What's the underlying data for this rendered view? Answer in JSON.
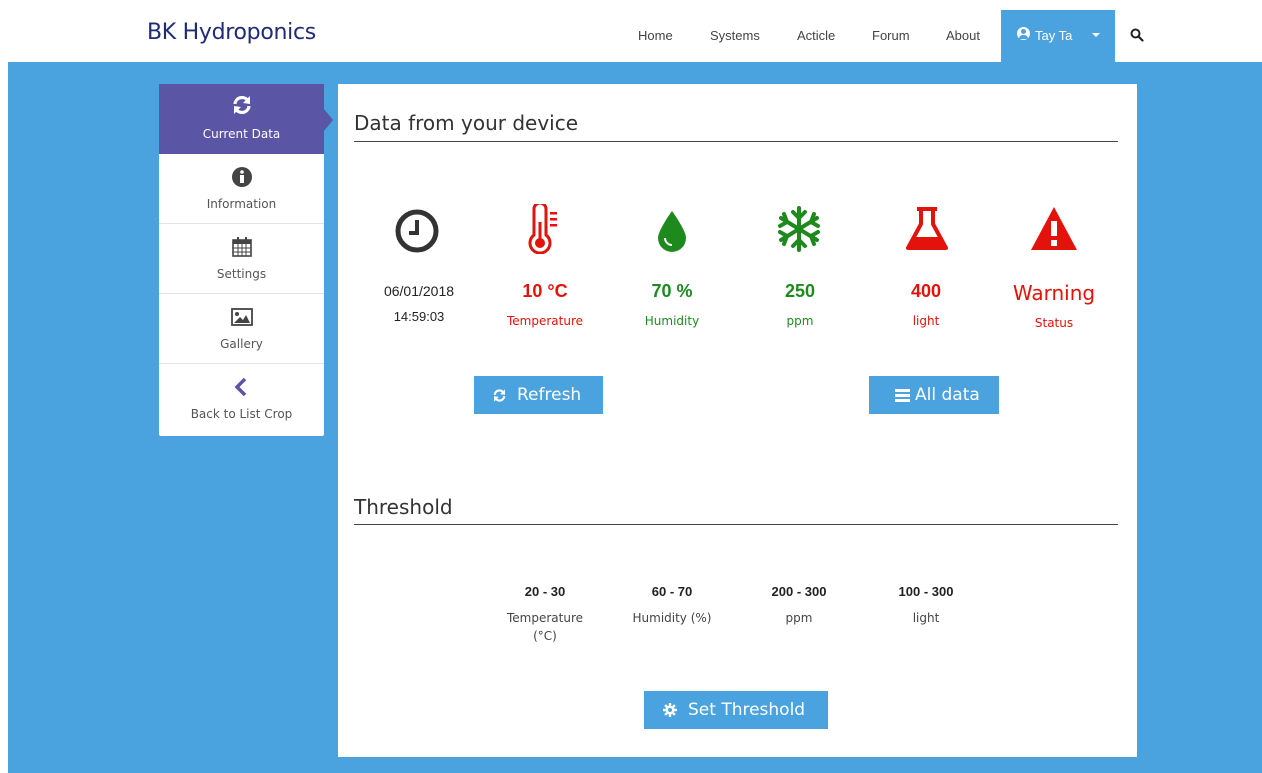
{
  "brand": "BK Hydroponics",
  "nav": {
    "items": [
      "Home",
      "Systems",
      "Acticle",
      "Forum",
      "About"
    ],
    "user": "Tay Ta"
  },
  "sidebar": {
    "items": [
      {
        "label": "Current Data",
        "icon": "refresh-icon"
      },
      {
        "label": "Information",
        "icon": "info-icon"
      },
      {
        "label": "Settings",
        "icon": "calendar-icon"
      },
      {
        "label": "Gallery",
        "icon": "image-icon"
      },
      {
        "label": "Back to List Crop",
        "icon": "chevron-left-icon"
      }
    ]
  },
  "current": {
    "title": "Data from your device",
    "date": "06/01/2018",
    "time": "14:59:03",
    "temperature": {
      "value": "10 °C",
      "label": "Temperature"
    },
    "humidity": {
      "value": "70 %",
      "label": "Humidity"
    },
    "ppm": {
      "value": "250",
      "label": "ppm"
    },
    "light": {
      "value": "400",
      "label": "light"
    },
    "status": {
      "value": "Warning",
      "label": "Status"
    },
    "refresh_label": "Refresh",
    "alldata_label": "All data"
  },
  "threshold": {
    "title": "Threshold",
    "temperature": {
      "value": "20 - 30",
      "label1": "Temperature",
      "label2": "(°C)"
    },
    "humidity": {
      "value": "60 - 70",
      "label": "Humidity (%)"
    },
    "ppm": {
      "value": "200 - 300",
      "label": "ppm"
    },
    "light": {
      "value": "100 - 300",
      "label": "light"
    },
    "button_label": "Set Threshold"
  },
  "colors": {
    "accent": "#4aa3df",
    "sidebar_active": "#5b55a6",
    "red": "#e3120b",
    "green": "#1e8a1e",
    "dark": "#333333"
  }
}
